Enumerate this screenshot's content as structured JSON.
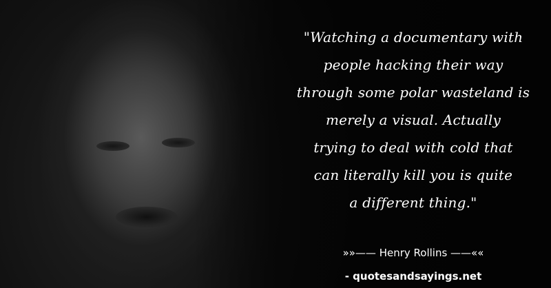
{
  "quote": {
    "lines": [
      "\"Watching a documentary with",
      "people hacking their way",
      "through some polar wasteland is",
      "merely a visual. Actually",
      "trying to deal with cold that",
      "can literally kill you is quite",
      "a different thing.\""
    ]
  },
  "attribution": {
    "author": "»»—— Henry Rollins ——««",
    "site": "- quotesandsayings.net"
  }
}
